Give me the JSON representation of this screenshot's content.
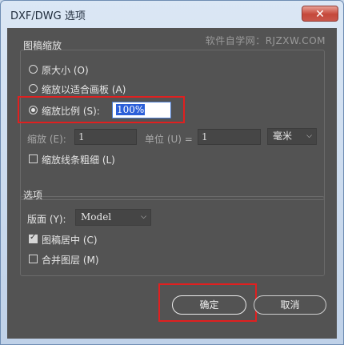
{
  "window": {
    "title": "DXF/DWG 选项",
    "close_glyph": "✕"
  },
  "watermark": "软件自学网：RJZXW.COM",
  "scale_group": {
    "title": "图稿缩放",
    "options": {
      "original": "原大小 (O)",
      "fit_artboard": "缩放以适合画板 (A)",
      "scale_ratio": "缩放比例 (S):"
    },
    "scale_ratio_value": "100%",
    "scale_label": "缩放 (E):",
    "scale_value": "1",
    "unit_label": "单位 (U) =",
    "unit_value": "1",
    "unit_select": "毫米",
    "scale_lineweights": "缩放线条粗细 (L)"
  },
  "options_group": {
    "title": "选项",
    "layout_label": "版面 (Y):",
    "layout_select": "Model",
    "center_artwork": "图稿居中 (C)",
    "merge_layers": "合并图层 (M)"
  },
  "buttons": {
    "ok": "确定",
    "cancel": "取消"
  },
  "state": {
    "selected_option": "scale_ratio",
    "center_artwork_checked": true,
    "merge_layers_checked": false,
    "scale_lineweights_checked": false
  },
  "colors": {
    "dialog_bg": "#535353",
    "highlight": "#e02020",
    "selection": "#2b5fd9"
  }
}
